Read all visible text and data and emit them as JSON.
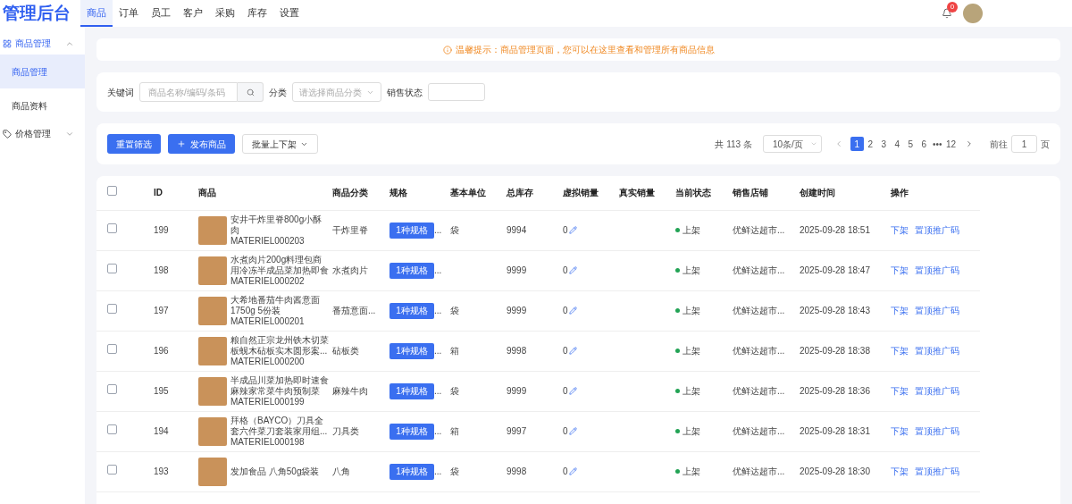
{
  "header": {
    "logo": "管理后台",
    "nav": [
      {
        "label": "商品",
        "selected": true
      },
      {
        "label": "订单",
        "selected": false
      },
      {
        "label": "员工",
        "selected": false
      },
      {
        "label": "客户",
        "selected": false
      },
      {
        "label": "采购",
        "selected": false
      },
      {
        "label": "库存",
        "selected": false
      },
      {
        "label": "设置",
        "selected": false
      }
    ],
    "notification_count": "0"
  },
  "sidebar": {
    "groups": [
      {
        "label": "商品管理",
        "kind": "grid",
        "expanded": true,
        "children": [
          {
            "label": "商品管理",
            "selected": true
          },
          {
            "label": "商品资料",
            "selected": false
          }
        ]
      },
      {
        "label": "价格管理",
        "kind": "tag",
        "expanded": false
      }
    ]
  },
  "tip": "温馨提示：商品管理页面，您可以在这里查看和管理所有商品信息",
  "filters": {
    "keyword_label": "关键词",
    "keyword_placeholder": "商品名称/编码/条码",
    "category_label": "分类",
    "category_placeholder": "请选择商品分类",
    "status_label": "销售状态"
  },
  "toolbar": {
    "reset": "重置筛选",
    "publish": "发布商品",
    "batch": "批量上下架"
  },
  "pagination": {
    "total": "共 113 条",
    "page_size": "10条/页",
    "pages": [
      {
        "label": "1",
        "selected": true
      },
      {
        "label": "2",
        "selected": false
      },
      {
        "label": "3",
        "selected": false
      },
      {
        "label": "4",
        "selected": false
      },
      {
        "label": "5",
        "selected": false
      },
      {
        "label": "6",
        "selected": false
      },
      {
        "label": "•••",
        "selected": false
      },
      {
        "label": "12",
        "selected": false
      }
    ],
    "goto_label": "前往",
    "goto_value": "1",
    "goto_suffix": "页"
  },
  "table": {
    "all_checked": false,
    "columns": [
      "ID",
      "商品",
      "商品分类",
      "规格",
      "基本单位",
      "总库存",
      "虚拟销量",
      "真实销量",
      "当前状态",
      "销售店铺",
      "创建时间",
      "操作"
    ],
    "rows": [
      {
        "checked": false,
        "id": "199",
        "name": "安井干炸里脊800g小酥肉",
        "code": "MATERIEL000203",
        "category": "干炸里脊",
        "spec": "1种规格",
        "spec_more": "...",
        "unit": "袋",
        "stock": "9994",
        "virtual_sales": "0",
        "status": "上架",
        "store": "优鲜达超市...",
        "created": "2025-09-28 18:51",
        "actions": [
          "下架",
          "置顶推广码"
        ]
      },
      {
        "checked": false,
        "id": "198",
        "name": "水煮肉片200g料理包商用冷冻半成品菜加热即食",
        "code": "MATERIEL000202",
        "category": "水煮肉片",
        "spec": "1种规格",
        "spec_more": "...",
        "unit": "",
        "stock": "9999",
        "virtual_sales": "0",
        "status": "上架",
        "store": "优鲜达超市...",
        "created": "2025-09-28 18:47",
        "actions": [
          "下架",
          "置顶推广码"
        ]
      },
      {
        "checked": false,
        "id": "197",
        "name": "大希地番茄牛肉酱意面1750g 5份装",
        "code": "MATERIEL000201",
        "category": "番茄意面...",
        "spec": "1种规格",
        "spec_more": "...",
        "unit": "袋",
        "stock": "9999",
        "virtual_sales": "0",
        "status": "上架",
        "store": "优鲜达超市...",
        "created": "2025-09-28 18:43",
        "actions": [
          "下架",
          "置顶推广码"
        ]
      },
      {
        "checked": false,
        "id": "196",
        "name": "粮自然正宗龙州铁木切菜板蚬木砧板实木圆形案...",
        "code": "MATERIEL000200",
        "category": "砧板类",
        "spec": "1种规格",
        "spec_more": "...",
        "unit": "箱",
        "stock": "9998",
        "virtual_sales": "0",
        "status": "上架",
        "store": "优鲜达超市...",
        "created": "2025-09-28 18:38",
        "actions": [
          "下架",
          "置顶推广码"
        ]
      },
      {
        "checked": false,
        "id": "195",
        "name": "半成品川菜加热即时速食麻辣家常菜牛肉预制菜",
        "code": "MATERIEL000199",
        "category": "麻辣牛肉",
        "spec": "1种规格",
        "spec_more": "...",
        "unit": "袋",
        "stock": "9999",
        "virtual_sales": "0",
        "status": "上架",
        "store": "优鲜达超市...",
        "created": "2025-09-28 18:36",
        "actions": [
          "下架",
          "置顶推广码"
        ]
      },
      {
        "checked": false,
        "id": "194",
        "name": "拜格（BAYCO）刀具全套六件菜刀套装家用组...",
        "code": "MATERIEL000198",
        "category": "刀具类",
        "spec": "1种规格",
        "spec_more": "...",
        "unit": "箱",
        "stock": "9997",
        "virtual_sales": "0",
        "status": "上架",
        "store": "优鲜达超市...",
        "created": "2025-09-28 18:31",
        "actions": [
          "下架",
          "置顶推广码"
        ]
      },
      {
        "checked": false,
        "id": "193",
        "name": "发加食品 八角50g袋装",
        "code": "",
        "category": "八角",
        "spec": "1种规格",
        "spec_more": "...",
        "unit": "袋",
        "stock": "9998",
        "virtual_sales": "0",
        "status": "上架",
        "store": "优鲜达超市...",
        "created": "2025-09-28 18:30",
        "actions": [
          "下架",
          "置顶推广码"
        ]
      }
    ]
  }
}
